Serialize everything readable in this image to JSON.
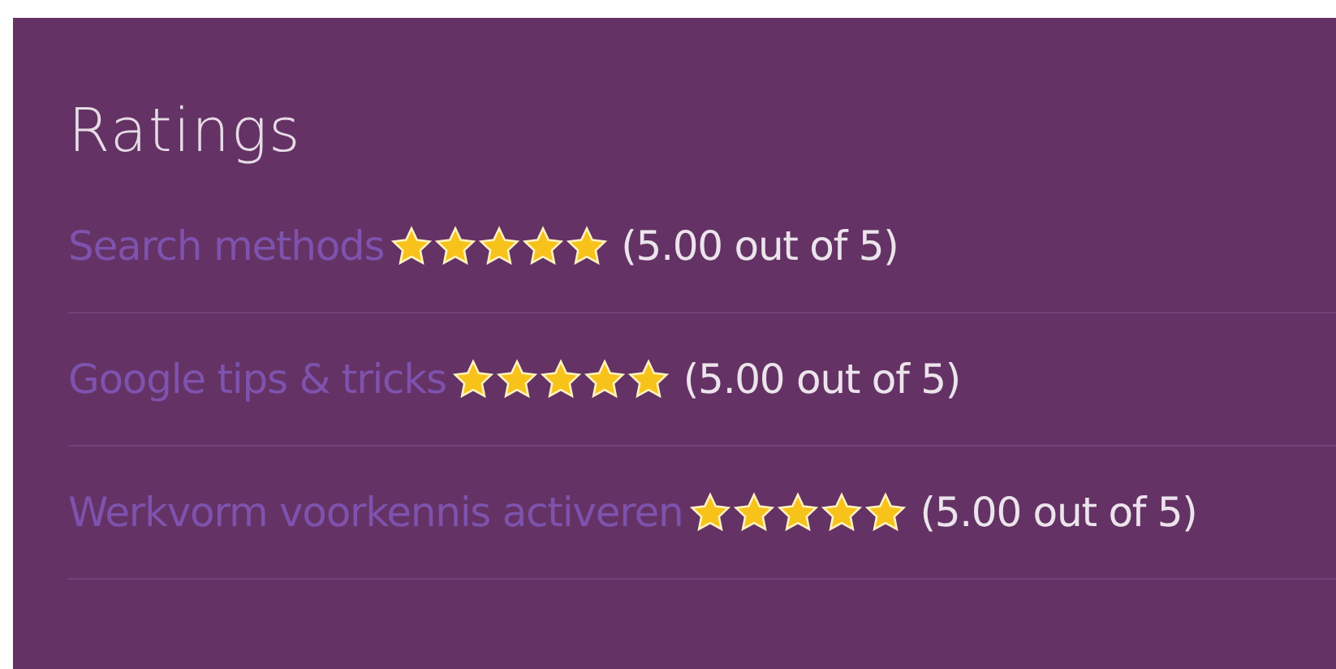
{
  "title": "Ratings",
  "ratings": [
    {
      "name": "Search methods",
      "stars": 5,
      "reading": "(5.00 out of 5)"
    },
    {
      "name": "Google tips & tricks",
      "stars": 5,
      "reading": "(5.00 out of 5)"
    },
    {
      "name": "Werkvorm voorkennis activeren",
      "stars": 5,
      "reading": "(5.00 out of 5)"
    }
  ]
}
